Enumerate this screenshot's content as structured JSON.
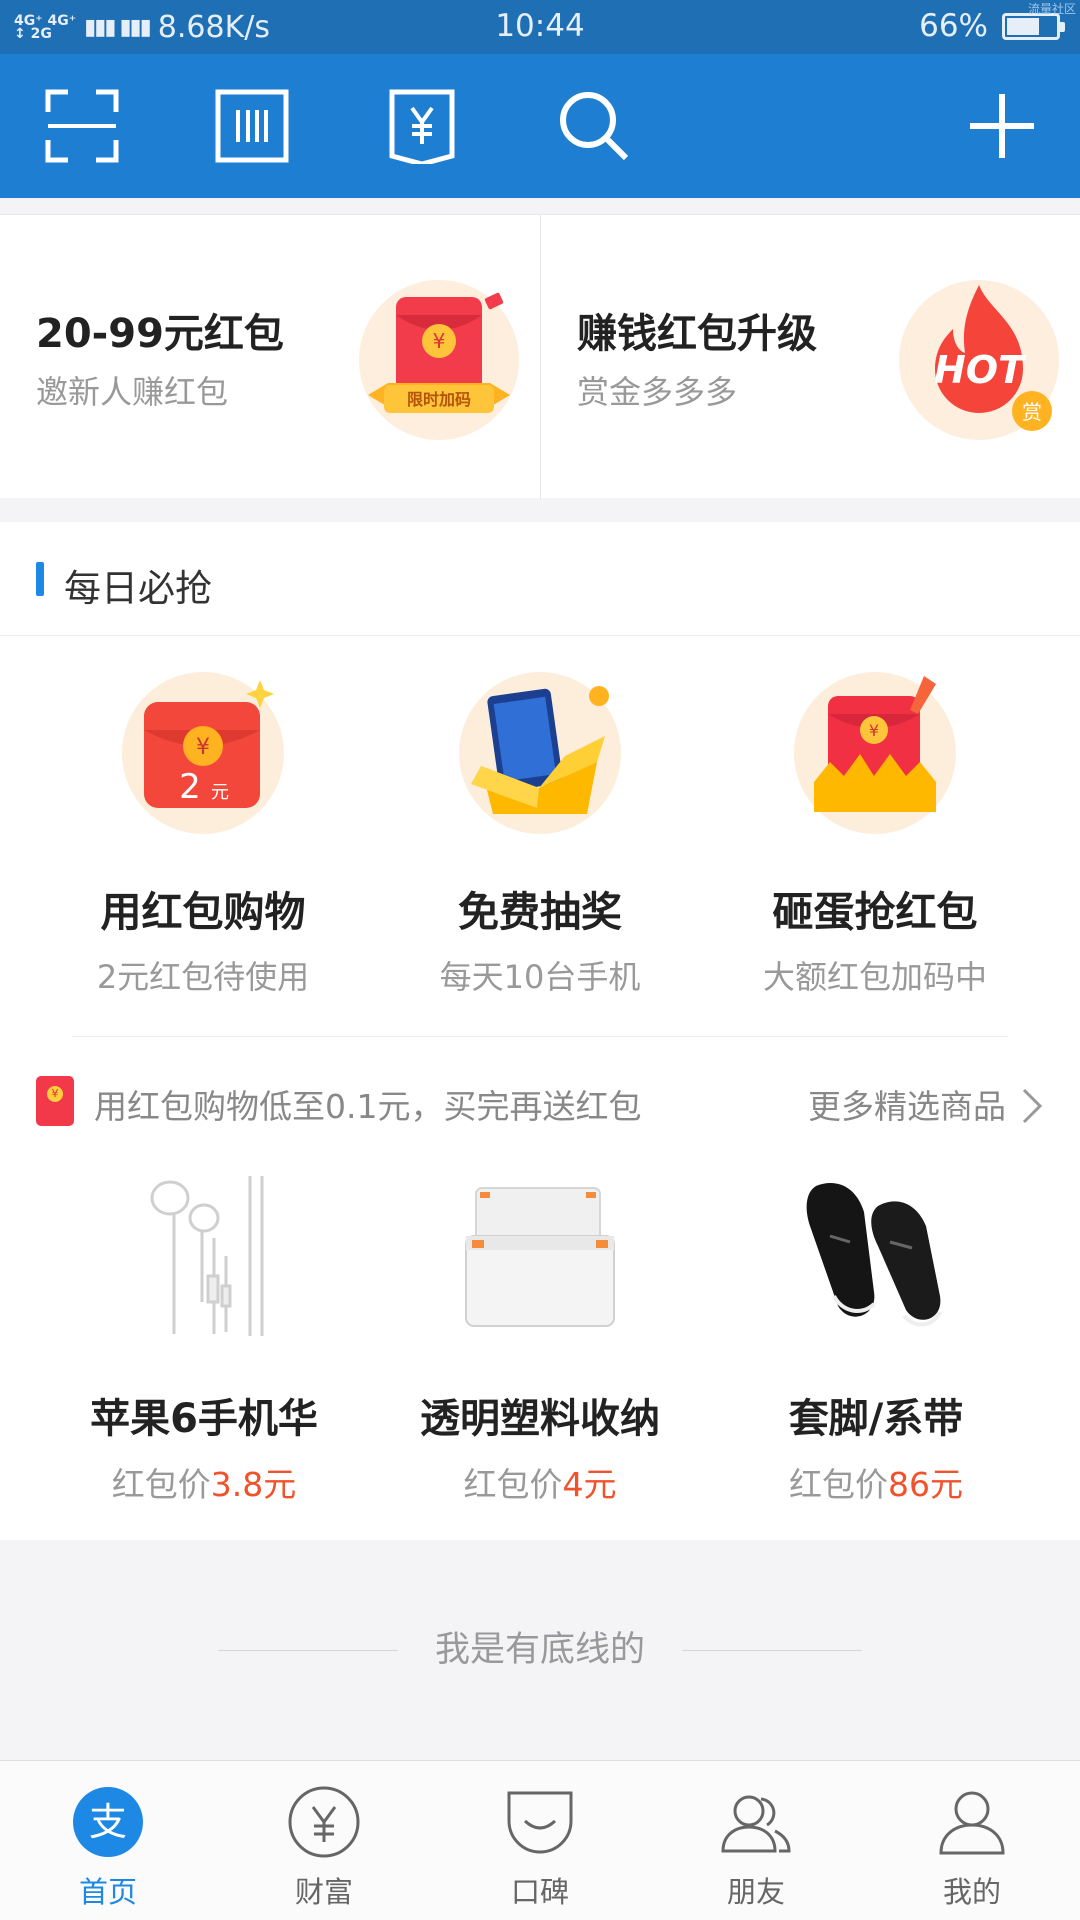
{
  "status_bar": {
    "network_label": "4G⁺ 4G⁺ 2G 2G",
    "speed": "8.68K/s",
    "time": "10:44",
    "battery": "66%",
    "battery_level": 0.66,
    "corner_text": "流量社区"
  },
  "app_bar": {
    "icons": [
      "scan-icon",
      "barcode-pay-icon",
      "collect-money-icon",
      "search-icon",
      "plus-icon"
    ],
    "color": "#1e7fd2"
  },
  "promo": [
    {
      "title": "20-99元红包",
      "subtitle": "邀新人赚红包",
      "badge": "限时加码"
    },
    {
      "title": "赚钱红包升级",
      "subtitle": "赏金多多多",
      "badge": "HOT",
      "badge_small": "赏"
    }
  ],
  "daily": {
    "heading": "每日必抢",
    "features": [
      {
        "title": "用红包购物",
        "subtitle": "2元红包待使用",
        "envelope_value": "2",
        "envelope_unit": "元"
      },
      {
        "title": "免费抽奖",
        "subtitle": "每天10台手机"
      },
      {
        "title": "砸蛋抢红包",
        "subtitle": "大额红包加码中"
      }
    ],
    "notice": {
      "text": "用红包购物低至0.1元，买完再送红包",
      "more": "更多精选商品"
    },
    "products": [
      {
        "name": "苹果6手机华",
        "price_prefix": "红包价",
        "price": "3.8元"
      },
      {
        "name": "透明塑料收纳",
        "price_prefix": "红包价",
        "price": "4元"
      },
      {
        "name": "套脚/系带",
        "price_prefix": "红包价",
        "price": "86元"
      }
    ]
  },
  "bottom_line": "我是有底线的",
  "tabs": [
    {
      "label": "首页",
      "icon": "home-alipay-icon",
      "active": true
    },
    {
      "label": "财富",
      "icon": "wealth-icon",
      "active": false
    },
    {
      "label": "口碑",
      "icon": "koubei-icon",
      "active": false
    },
    {
      "label": "朋友",
      "icon": "friends-icon",
      "active": false
    },
    {
      "label": "我的",
      "icon": "profile-icon",
      "active": false
    }
  ],
  "colors": {
    "brand": "#1e7fd2",
    "status_bar": "#1f6fb4",
    "price": "#f1522b",
    "active_tab": "#1e88e5"
  }
}
